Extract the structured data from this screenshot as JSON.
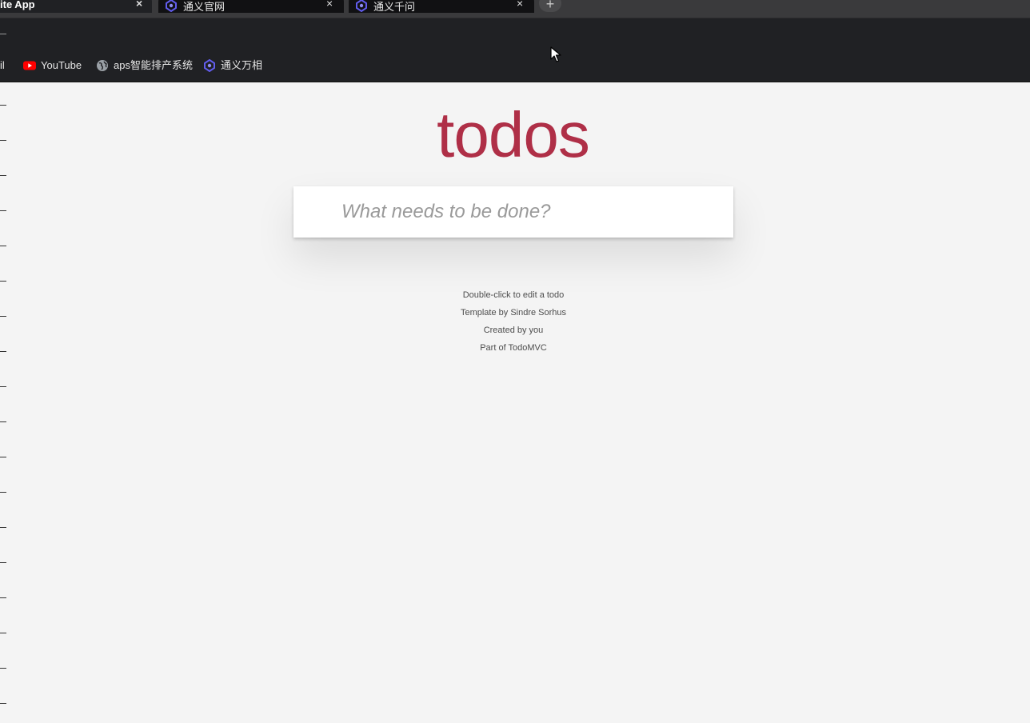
{
  "browser": {
    "tabs": [
      {
        "title": "ite App",
        "active": true
      },
      {
        "title": "通义官网",
        "active": false
      },
      {
        "title": "通义千问",
        "active": false
      }
    ],
    "tab_close_glyph": "×",
    "new_tab_glyph": "+",
    "bookmarks": [
      {
        "label": "il",
        "icon": "gmail-icon"
      },
      {
        "label": "YouTube",
        "icon": "youtube-icon"
      },
      {
        "label": "aps智能排产系统",
        "icon": "globe-icon"
      },
      {
        "label": "通义万相",
        "icon": "tongyi-icon"
      }
    ],
    "colors": {
      "chrome_dark": "#202124",
      "tabstrip": "#3a3a3c",
      "youtube_red": "#ff0000",
      "tongyi_purple": "#615ced"
    }
  },
  "app": {
    "title": "todos",
    "new_todo_placeholder": "What needs to be done?",
    "new_todo_value": "",
    "title_color": "#af2f47"
  },
  "info": {
    "line1": "Double-click to edit a todo",
    "line2": "Template by Sindre Sorhus",
    "line3": "Created by you",
    "line4": "Part of TodoMVC"
  }
}
